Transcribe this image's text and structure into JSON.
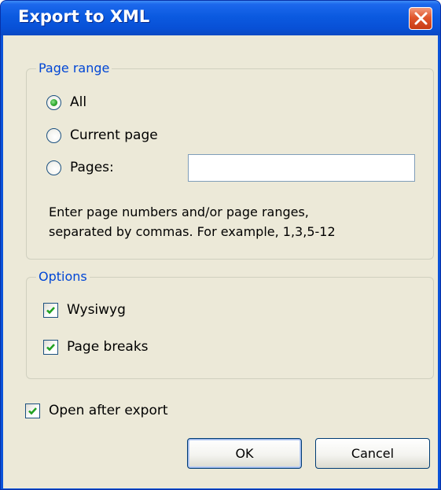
{
  "dialog": {
    "title": "Export to XML",
    "close_icon": "close-icon"
  },
  "page_range": {
    "legend": "Page range",
    "options": [
      {
        "label": "All",
        "checked": true
      },
      {
        "label": "Current page",
        "checked": false
      },
      {
        "label": "Pages:",
        "checked": false
      }
    ],
    "pages_input": {
      "value": "",
      "placeholder": ""
    },
    "hint_line1": "Enter page numbers and/or page ranges,",
    "hint_line2": "separated by commas. For example, 1,3,5-12"
  },
  "options": {
    "legend": "Options",
    "wysiwyg": {
      "label": "Wysiwyg",
      "checked": true
    },
    "page_breaks": {
      "label": "Page breaks",
      "checked": true
    }
  },
  "open_after_export": {
    "label": "Open after export",
    "checked": true
  },
  "buttons": {
    "ok": "OK",
    "cancel": "Cancel"
  },
  "colors": {
    "titlebar": "#0a53d9",
    "dialog_background": "#ece9d8",
    "group_legend": "#0046d5",
    "close_button": "#e0562d",
    "check_mark": "#21a121"
  }
}
